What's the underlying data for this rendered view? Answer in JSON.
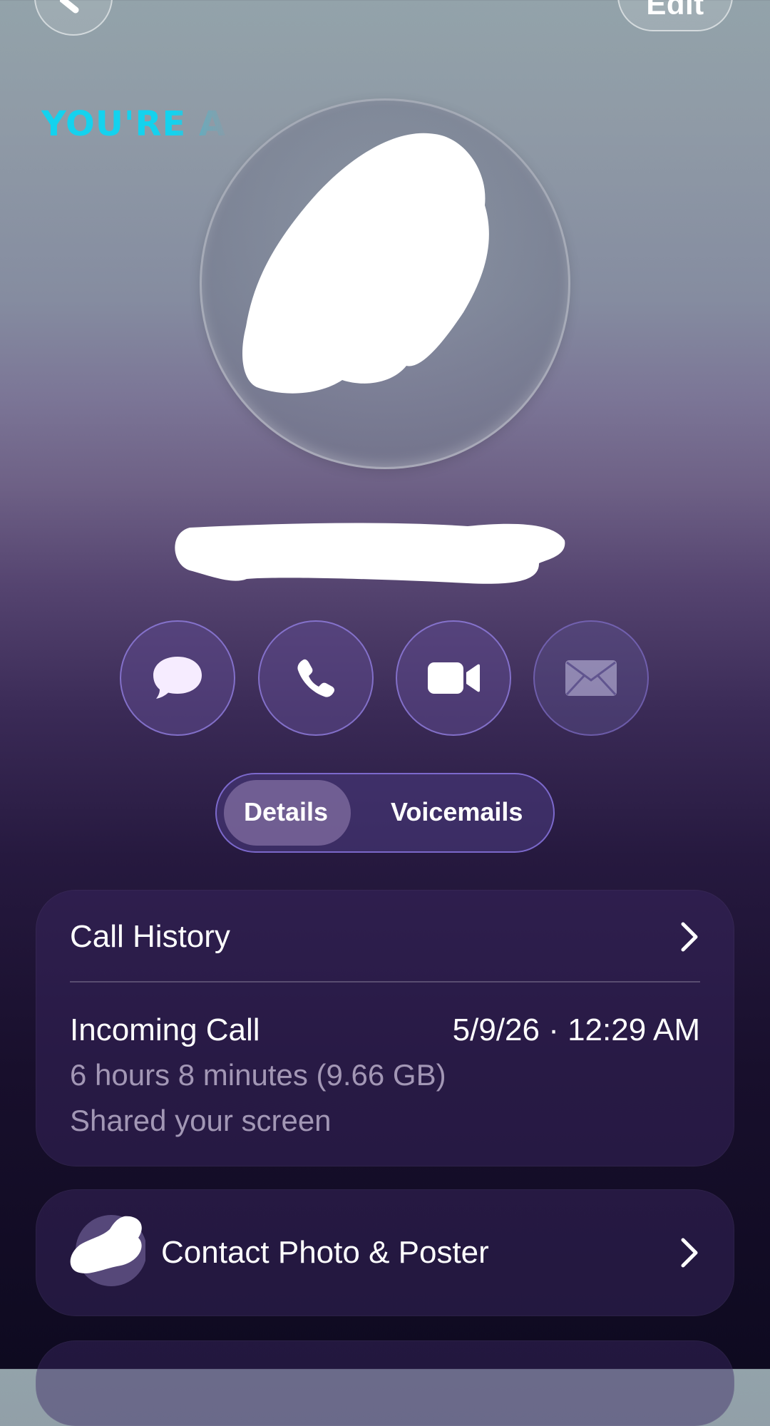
{
  "header": {
    "back_icon": "chevron-left-icon",
    "edit_label": "Edit"
  },
  "overlay": {
    "text": "YOU'RE A"
  },
  "contact": {
    "avatar": "contact-avatar-redacted",
    "name_redacted": true
  },
  "actions": [
    {
      "name": "message",
      "icon": "message-bubble-icon",
      "enabled": true
    },
    {
      "name": "call",
      "icon": "phone-icon",
      "enabled": true
    },
    {
      "name": "video",
      "icon": "video-camera-icon",
      "enabled": true
    },
    {
      "name": "mail",
      "icon": "envelope-icon",
      "enabled": false
    }
  ],
  "segmented": {
    "tabs": [
      "Details",
      "Voicemails"
    ],
    "selected": "Details"
  },
  "call_history": {
    "title": "Call History",
    "entry": {
      "type": "Incoming Call",
      "datetime": "5/9/26 · 12:29 AM",
      "duration": "6 hours 8 minutes (9.66 GB)",
      "note": "Shared your screen"
    }
  },
  "contact_photo": {
    "label": "Contact Photo & Poster"
  },
  "colors": {
    "button_border": "#9682e6",
    "overlay_text": "#14d2ee",
    "secondary_text": "#b4aac8"
  }
}
